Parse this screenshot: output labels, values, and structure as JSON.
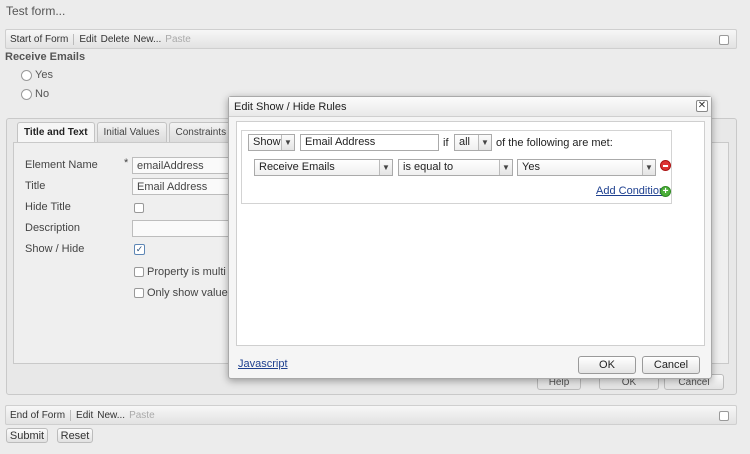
{
  "page": {
    "title": "Test form..."
  },
  "start_bar": {
    "label": "Start of Form",
    "actions": [
      "Edit",
      "Delete",
      "New...",
      "Paste"
    ]
  },
  "group": {
    "title": "Receive Emails",
    "options": [
      "Yes",
      "No"
    ]
  },
  "tabs": [
    "Title and Text",
    "Initial Values",
    "Constraints"
  ],
  "fields": {
    "element_name_label": "Element Name",
    "element_name_required": "*",
    "element_name_value": "emailAddress",
    "title_label": "Title",
    "title_value": "Email Address",
    "hide_title_label": "Hide Title",
    "description_label": "Description",
    "show_hide_label": "Show / Hide",
    "show_hide_checked_mark": "✓",
    "multi_value_label": "Property is multi va",
    "only_show_value_label": "Only show value"
  },
  "bg_buttons": {
    "help": "Help",
    "ok": "OK",
    "cancel": "Cancel"
  },
  "end_bar": {
    "label": "End of Form",
    "actions": [
      "Edit",
      "New...",
      "Paste"
    ]
  },
  "form_controls": {
    "submit": "Submit",
    "reset": "Reset"
  },
  "dialog": {
    "title": "Edit Show / Hide Rules",
    "close_glyph": "✕",
    "rule_header": {
      "action_select": "Show",
      "target_input": "Email Address",
      "if_text": "if",
      "match_select": "all",
      "tail_text": "of the following are met:"
    },
    "condition": {
      "field_select": "Receive Emails",
      "operator_select": "is equal to",
      "value_select": "Yes"
    },
    "add_condition_label": "Add Condition",
    "javascript_link": "Javascript",
    "ok_label": "OK",
    "cancel_label": "Cancel"
  },
  "icons": {
    "dropdown": "chevron-down-icon",
    "remove": "remove-circle-icon",
    "add": "add-circle-icon",
    "close": "close-icon"
  },
  "colors": {
    "link": "#1d3f8f",
    "remove": "#dd3333",
    "add": "#4caf3a"
  }
}
